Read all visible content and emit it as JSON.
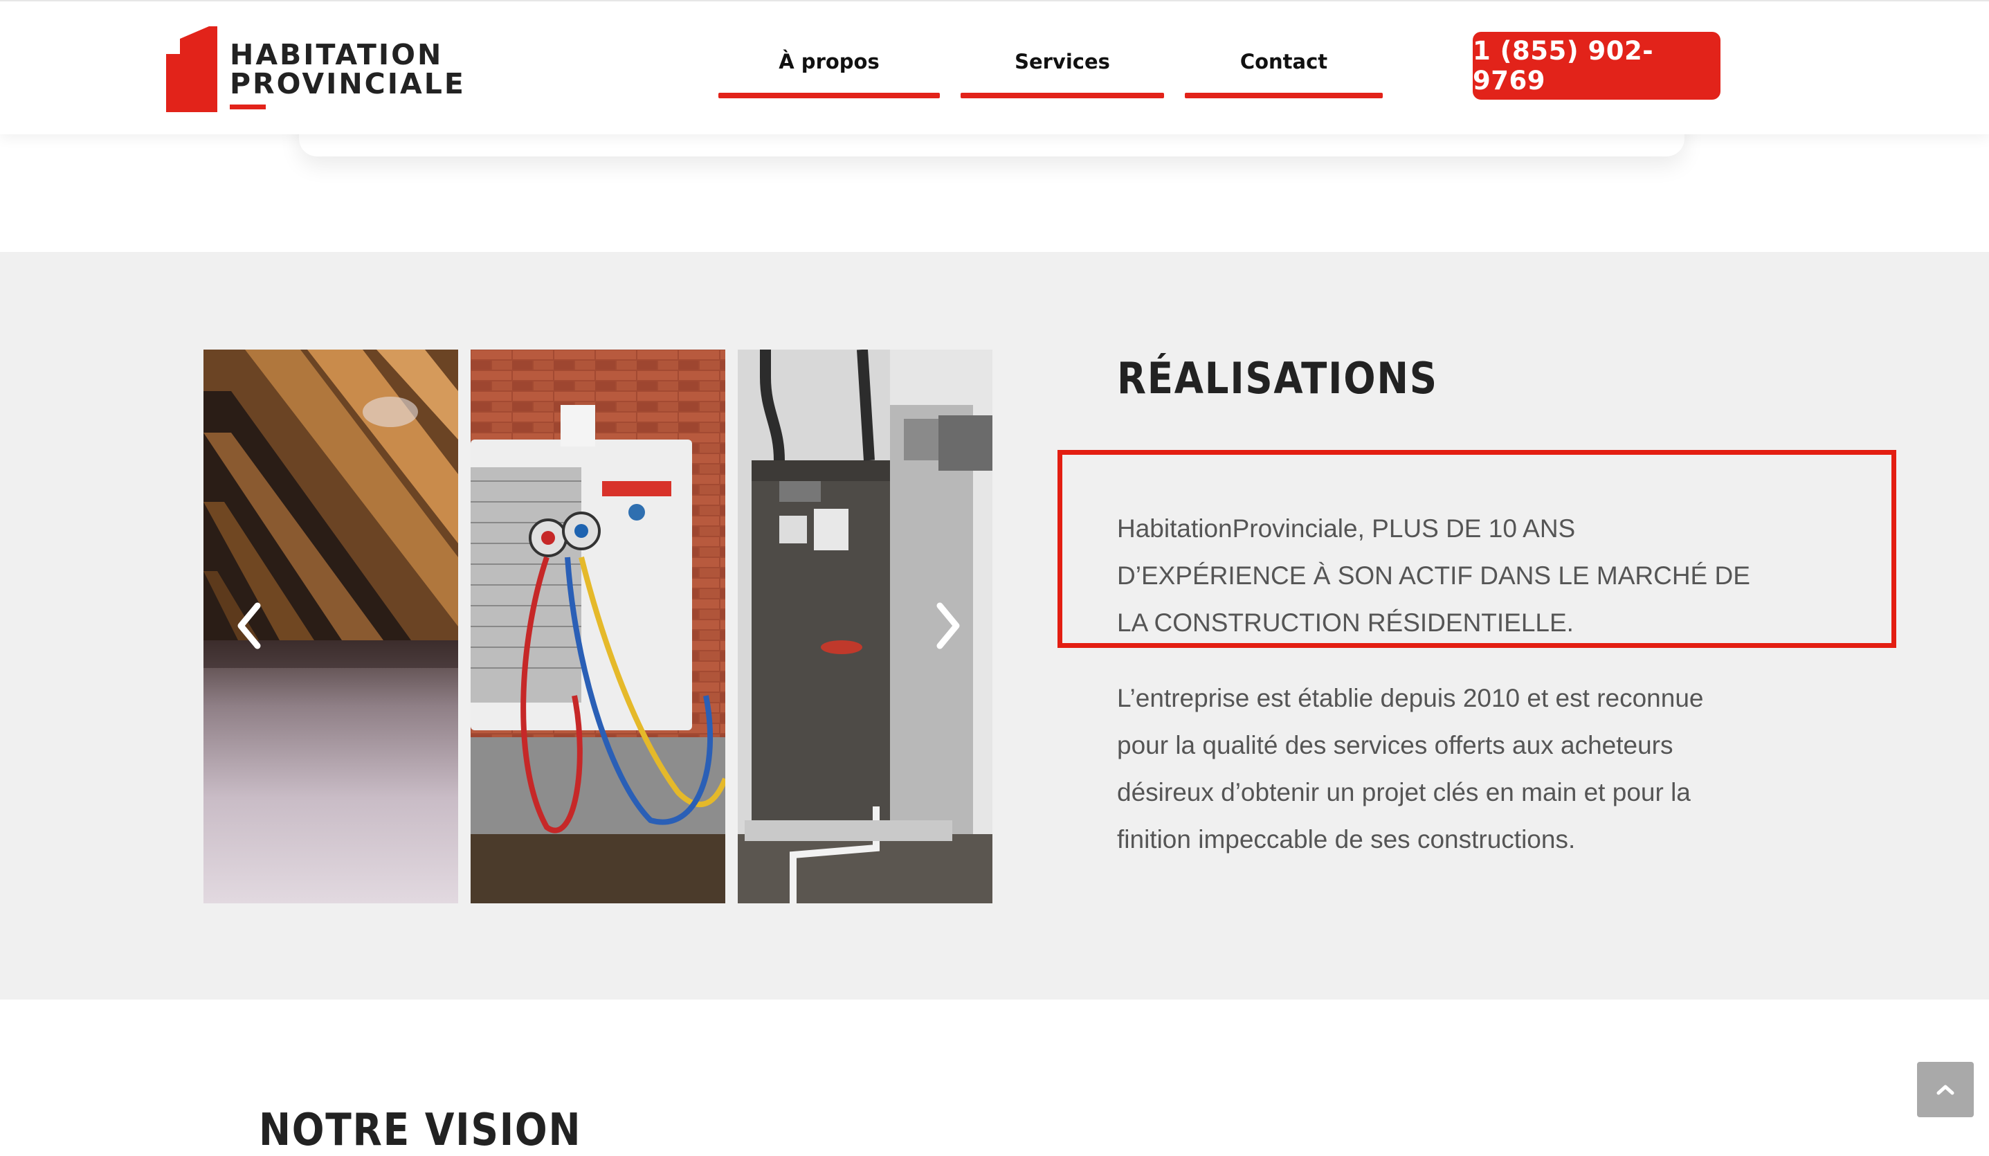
{
  "header": {
    "logo_line1": "HABITATION",
    "logo_line2": "PROVINCIALE",
    "nav": [
      {
        "label": "À propos"
      },
      {
        "label": "Services"
      },
      {
        "label": "Contact"
      }
    ],
    "phone": "1 (855) 902-9769",
    "accent_color": "#e2231a"
  },
  "gallery": {
    "images": [
      {
        "icon": "attic-insulation-photo"
      },
      {
        "icon": "heat-pump-outdoor-unit-photo"
      },
      {
        "icon": "furnace-unit-photo"
      }
    ],
    "prev_icon": "chevron-left-icon",
    "next_icon": "chevron-right-icon"
  },
  "realisations": {
    "heading": "RÉALISATIONS",
    "highlight_lines": [
      "HabitationProvinciale, PLUS DE 10 ANS",
      "D’EXPÉRIENCE À SON ACTIF DANS LE MARCHÉ DE",
      "LA CONSTRUCTION RÉSIDENTIELLE."
    ],
    "body_lines": [
      "L’entreprise est établie depuis 2010 et est reconnue",
      "pour la qualité des services offerts aux acheteurs",
      "désireux d’obtenir un projet clés en main et pour la",
      "finition impeccable de ses constructions."
    ],
    "highlight_color": "#e31e12"
  },
  "vision": {
    "heading": "NOTRE VISION"
  },
  "scroll_top_icon": "chevron-up-icon"
}
